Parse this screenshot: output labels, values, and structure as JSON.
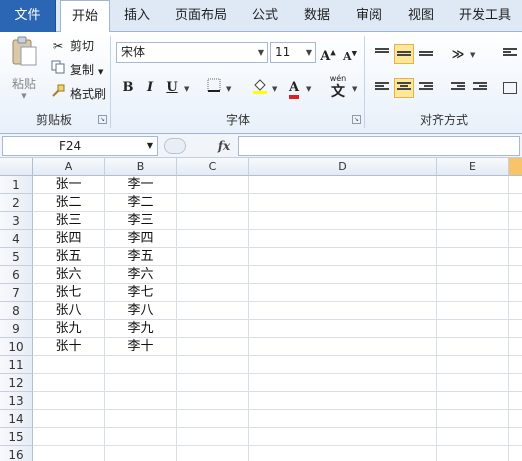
{
  "tabs": [
    "文件",
    "开始",
    "插入",
    "页面布局",
    "公式",
    "数据",
    "审阅",
    "视图",
    "开发工具"
  ],
  "clipboard": {
    "paste_label": "粘贴",
    "cut_label": "剪切",
    "copy_label": "复制",
    "format_painter_label": "格式刷",
    "group_label": "剪贴板"
  },
  "font": {
    "font_name": "宋体",
    "font_size": "11",
    "bold_label": "B",
    "italic_label": "I",
    "underline_label": "U",
    "group_label": "字体",
    "font_color": "#e02020",
    "fill_color": "#ffff00",
    "wen_label": "wén"
  },
  "alignment": {
    "group_label": "对齐方式"
  },
  "formula_bar": {
    "name_box": "F24",
    "fx_label": "fx",
    "formula": ""
  },
  "grid": {
    "columns": [
      "A",
      "B",
      "C",
      "D",
      "E"
    ],
    "rows": [
      "1",
      "2",
      "3",
      "4",
      "5",
      "6",
      "7",
      "8",
      "9",
      "10",
      "11",
      "12",
      "13",
      "14",
      "15",
      "16"
    ],
    "data": [
      [
        "张一",
        "李一"
      ],
      [
        "张二",
        "李二"
      ],
      [
        "张三",
        "李三"
      ],
      [
        "张四",
        "李四"
      ],
      [
        "张五",
        "李五"
      ],
      [
        "张六",
        "李六"
      ],
      [
        "张七",
        "李七"
      ],
      [
        "张八",
        "李八"
      ],
      [
        "张九",
        "李九"
      ],
      [
        "张十",
        "李十"
      ]
    ]
  }
}
